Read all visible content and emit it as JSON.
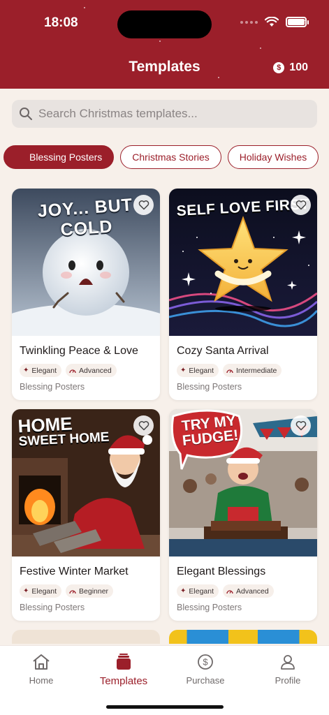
{
  "status": {
    "time": "18:08"
  },
  "header": {
    "title": "Templates",
    "coins": "100",
    "coin_symbol": "$"
  },
  "search": {
    "placeholder": "Search Christmas templates..."
  },
  "chips": [
    {
      "label": "Blessing Posters",
      "active": true
    },
    {
      "label": "Christmas Stories",
      "active": false
    },
    {
      "label": "Holiday Wishes",
      "active": false
    }
  ],
  "cards": [
    {
      "title": "Twinkling Peace & Love",
      "style": "Elegant",
      "level": "Advanced",
      "category": "Blessing Posters",
      "image_text": "JOY... BUT COLD"
    },
    {
      "title": "Cozy Santa Arrival",
      "style": "Elegant",
      "level": "Intermediate",
      "category": "Blessing Posters",
      "image_text": "SELF LOVE FIRST"
    },
    {
      "title": "Festive Winter Market",
      "style": "Elegant",
      "level": "Beginner",
      "category": "Blessing Posters",
      "image_text_1": "HOME",
      "image_text_2": "SWEET HOME"
    },
    {
      "title": "Elegant Blessings",
      "style": "Elegant",
      "level": "Advanced",
      "category": "Blessing Posters",
      "image_text_1": "TRY MY",
      "image_text_2": "FUDGE!"
    }
  ],
  "nav": [
    {
      "label": "Home",
      "icon": "home-icon",
      "active": false
    },
    {
      "label": "Templates",
      "icon": "templates-icon",
      "active": true
    },
    {
      "label": "Purchase",
      "icon": "dollar-icon",
      "active": false
    },
    {
      "label": "Profile",
      "icon": "profile-icon",
      "active": false
    }
  ],
  "colors": {
    "primary": "#9b1f2a",
    "background": "#f7f0ea",
    "tag_bg": "#f6efea"
  }
}
